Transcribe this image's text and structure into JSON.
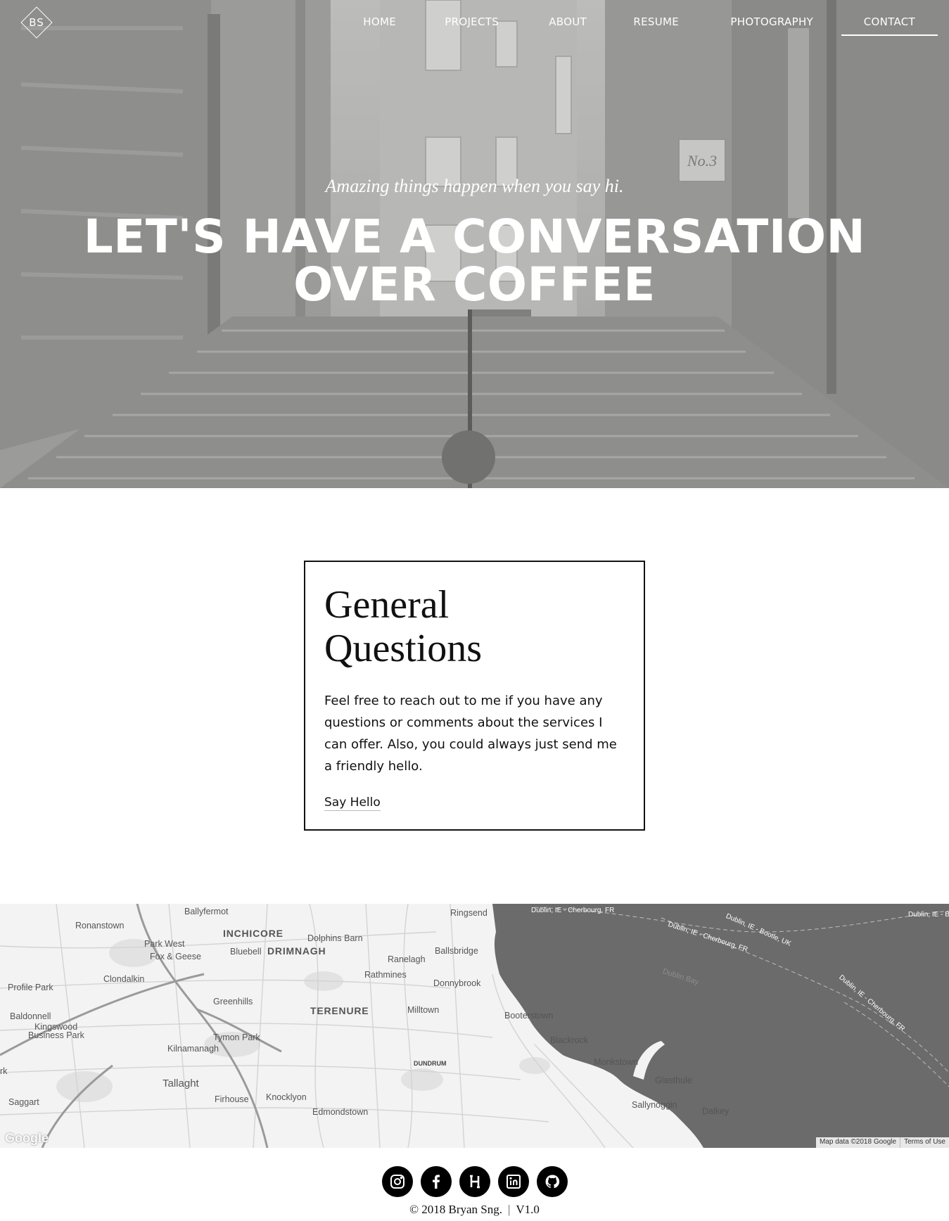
{
  "header": {
    "logo_text": "BS",
    "nav": [
      {
        "label": "HOME",
        "active": false
      },
      {
        "label": "PROJECTS",
        "active": false
      },
      {
        "label": "ABOUT",
        "active": false
      },
      {
        "label": "RESUME",
        "active": false
      },
      {
        "label": "PHOTOGRAPHY",
        "active": false
      },
      {
        "label": "CONTACT",
        "active": true
      }
    ]
  },
  "hero": {
    "tagline": "Amazing things happen when you say hi.",
    "headline_line1": "LET'S HAVE A CONVERSATION",
    "headline_line2": "OVER COFFEE",
    "sign_text": "No.3"
  },
  "card": {
    "title_line1": "General",
    "title_line2": "Questions",
    "body": "Feel free to reach out to me if you have any questions or comments about the services I can offer. Also, you could always just send me a friendly hello.",
    "link_label": "Say Hello"
  },
  "map": {
    "labels": {
      "ballyfermot": "Ballyfermot",
      "ronanstown": "Ronanstown",
      "inchicore": "INCHICORE",
      "dolphins_barn": "Dolphins Barn",
      "park_west": "Park West",
      "bluebell": "Bluebell",
      "drimnagh": "DRIMNAGH",
      "fox_geese": "Fox & Geese",
      "ringsend": "Ringsend",
      "ballsbridge": "Ballsbridge",
      "ranelagh": "Ranelagh",
      "rathmines": "Rathmines",
      "donnybrook": "Donnybrook",
      "clondalkin": "Clondalkin",
      "profile_park": "Profile Park",
      "greenhills": "Greenhills",
      "terenure": "TERENURE",
      "milltown": "Milltown",
      "booterstown": "Booterstown",
      "baldonnell": "Baldonnell",
      "kingswood": "Kingswood",
      "business_park": "Business Park",
      "tymon_park": "Tymon Park",
      "kilnamanagh": "Kilnamanagh",
      "blackrock": "Blackrock",
      "dundrum": "DUNDRUM",
      "monkstown": "Monkstown",
      "tallaght": "Tallaght",
      "glasthule": "Glasthule",
      "saggart": "Saggart",
      "firhouse": "Firhouse",
      "knocklyon": "Knocklyon",
      "edmondstown": "Edmondstown",
      "sallynoggin": "Sallynoggin",
      "dalkey": "Dalkey",
      "rk": "rk",
      "dublin_bay": "Dublin Bay",
      "ferry1": "Dublin, IE - Cherbourg, FR",
      "ferry2": "Dublin, IE - Bootle, UK",
      "ferry3": "Dublin, IE - Cherbourg, FR",
      "ferry4": "Dublin, IE - Cherbourg, FR",
      "ferry5": "Dublin, IE - B"
    },
    "google_logo": "Google",
    "map_data": "Map data ©2018 Google",
    "terms": "Terms of Use"
  },
  "footer": {
    "socials": [
      {
        "name": "instagram-icon"
      },
      {
        "name": "facebook-icon"
      },
      {
        "name": "hashnode-icon"
      },
      {
        "name": "linkedin-icon"
      },
      {
        "name": "github-icon"
      }
    ],
    "copyright": "© 2018 Bryan Sng.",
    "separator": "|",
    "version": "V1.0"
  }
}
